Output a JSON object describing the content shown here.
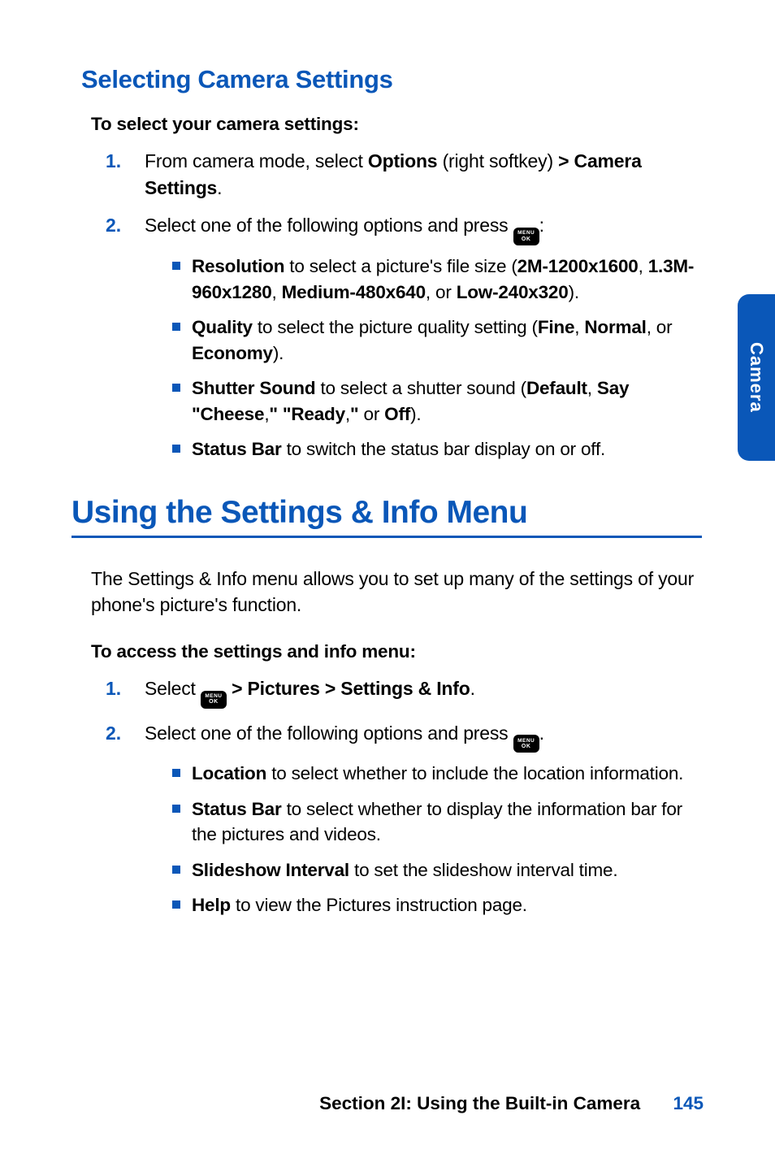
{
  "sideTab": "Camera",
  "section1": {
    "heading": "Selecting Camera Settings",
    "lead": "To select your camera settings:",
    "steps": [
      {
        "num": "1.",
        "pre": "From camera mode, select ",
        "b1": "Options",
        "mid": " (right softkey) ",
        "b2": "> Camera Settings",
        "post": "."
      },
      {
        "num": "2.",
        "pre": "Select one of the following options and press ",
        "post": ":",
        "bullets": [
          {
            "b1": "Resolution",
            "t1": " to select a picture's file size (",
            "b2": "2M-1200x1600",
            "t2": ", ",
            "b3": "1.3M-960x1280",
            "t3": ", ",
            "b4": "Medium-480x640",
            "t4": ", or ",
            "b5": "Low-240x320",
            "t5": ")."
          },
          {
            "b1": "Quality",
            "t1": " to select the picture quality setting (",
            "b2": "Fine",
            "t2": ", ",
            "b3": "Normal",
            "t3": ", or ",
            "b4": "Economy",
            "t4": ")."
          },
          {
            "b1": "Shutter Sound",
            "t1": " to select a shutter sound (",
            "b2": "Default",
            "t2": ", ",
            "b3": "Say \"Cheese",
            "t3": ",",
            "b4": "\" \"Ready",
            "t4": ",",
            "b5": "\"",
            "t5": " or ",
            "b6": "Off",
            "t6": ")."
          },
          {
            "b1": "Status Bar",
            "t1": " to switch the status bar display on or off."
          }
        ]
      }
    ]
  },
  "section2": {
    "heading": "Using the Settings & Info Menu",
    "intro": "The Settings & Info menu allows you to set up many of the settings of your phone's picture's function.",
    "lead": "To access the settings and info menu:",
    "steps": [
      {
        "num": "1.",
        "pre": "Select ",
        "bpath": " > Pictures > Settings & Info",
        "post": "."
      },
      {
        "num": "2.",
        "pre": "Select one of the following options and press ",
        "post": ".",
        "bullets": [
          {
            "b1": "Location",
            "t1": " to select whether to include the location information."
          },
          {
            "b1": "Status Bar",
            "t1": " to select whether to display the information bar for the pictures and videos."
          },
          {
            "b1": "Slideshow Interval",
            "t1": " to set the slideshow interval time."
          },
          {
            "b1": "Help",
            "t1": " to view the Pictures instruction page."
          }
        ]
      }
    ]
  },
  "footer": {
    "section": "Section 2I: Using the Built-in Camera",
    "page": "145"
  },
  "menuIcon": {
    "top": "MENU",
    "bottom": "OK"
  }
}
